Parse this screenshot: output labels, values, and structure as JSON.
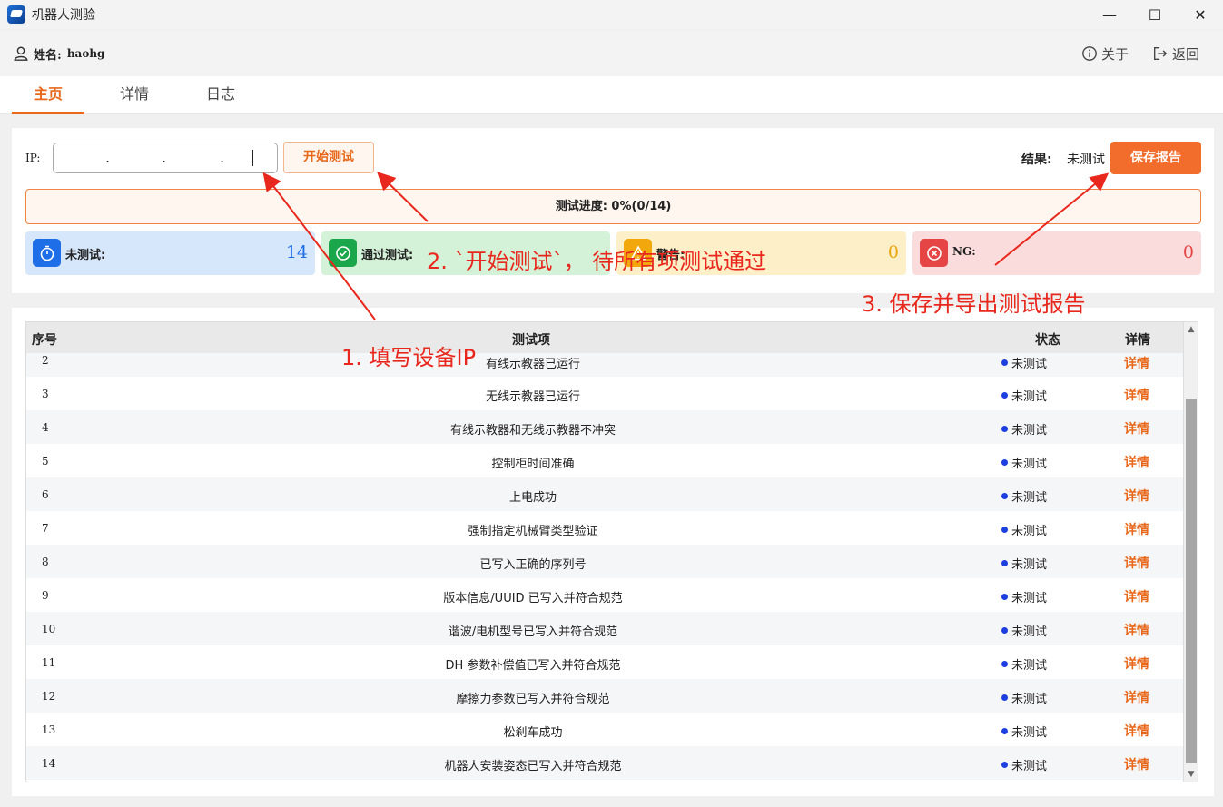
{
  "window": {
    "title": "机器人测验",
    "minimize": "—",
    "maximize": "☐",
    "close": "✕"
  },
  "user": {
    "label": "姓名:",
    "name": "haohg"
  },
  "top_actions": {
    "about": "关于",
    "back": "返回"
  },
  "tabs": [
    {
      "label": "主页",
      "active": true
    },
    {
      "label": "详情",
      "active": false
    },
    {
      "label": "日志",
      "active": false
    }
  ],
  "controls": {
    "ip_label": "IP:",
    "ip_separator": ".",
    "start_button": "开始测试",
    "result_label": "结果:",
    "result_value": "未测试",
    "save_button": "保存报告"
  },
  "progress": {
    "text": "测试进度: 0%(0/14)",
    "fraction": 0
  },
  "stats": {
    "untested": {
      "label": "未测试:",
      "value": "14"
    },
    "pass": {
      "label": "通过测试:",
      "value": ""
    },
    "warning": {
      "label": "警告:",
      "value": "0"
    },
    "ng": {
      "label": "NG:",
      "value": "0"
    }
  },
  "table": {
    "headers": {
      "no": "序号",
      "item": "测试项",
      "status": "状态",
      "detail": "详情"
    },
    "rows": [
      {
        "no": "2",
        "item": "有线示教器已运行",
        "status": "未测试",
        "detail": "详情"
      },
      {
        "no": "3",
        "item": "无线示教器已运行",
        "status": "未测试",
        "detail": "详情"
      },
      {
        "no": "4",
        "item": "有线示教器和无线示教器不冲突",
        "status": "未测试",
        "detail": "详情"
      },
      {
        "no": "5",
        "item": "控制柜时间准确",
        "status": "未测试",
        "detail": "详情"
      },
      {
        "no": "6",
        "item": "上电成功",
        "status": "未测试",
        "detail": "详情"
      },
      {
        "no": "7",
        "item": "强制指定机械臂类型验证",
        "status": "未测试",
        "detail": "详情"
      },
      {
        "no": "8",
        "item": "已写入正确的序列号",
        "status": "未测试",
        "detail": "详情"
      },
      {
        "no": "9",
        "item": "版本信息/UUID 已写入并符合规范",
        "status": "未测试",
        "detail": "详情"
      },
      {
        "no": "10",
        "item": "谐波/电机型号已写入并符合规范",
        "status": "未测试",
        "detail": "详情"
      },
      {
        "no": "11",
        "item": "DH 参数补偿值已写入并符合规范",
        "status": "未测试",
        "detail": "详情"
      },
      {
        "no": "12",
        "item": "摩擦力参数已写入并符合规范",
        "status": "未测试",
        "detail": "详情"
      },
      {
        "no": "13",
        "item": "松刹车成功",
        "status": "未测试",
        "detail": "详情"
      },
      {
        "no": "14",
        "item": "机器人安装姿态已写入并符合规范",
        "status": "未测试",
        "detail": "详情"
      }
    ]
  },
  "annotations": {
    "step1": "1. 填写设备IP",
    "step2": "2. `开始测试`， 待所有项测试通过",
    "step3": "3. 保存并导出测试报告",
    "color": "#e8281c"
  },
  "colors": {
    "accent": "#e8691c",
    "untested": "#1e6ee8",
    "pass": "#1aa64a",
    "warning": "#f2a80c",
    "ng": "#e64545"
  }
}
